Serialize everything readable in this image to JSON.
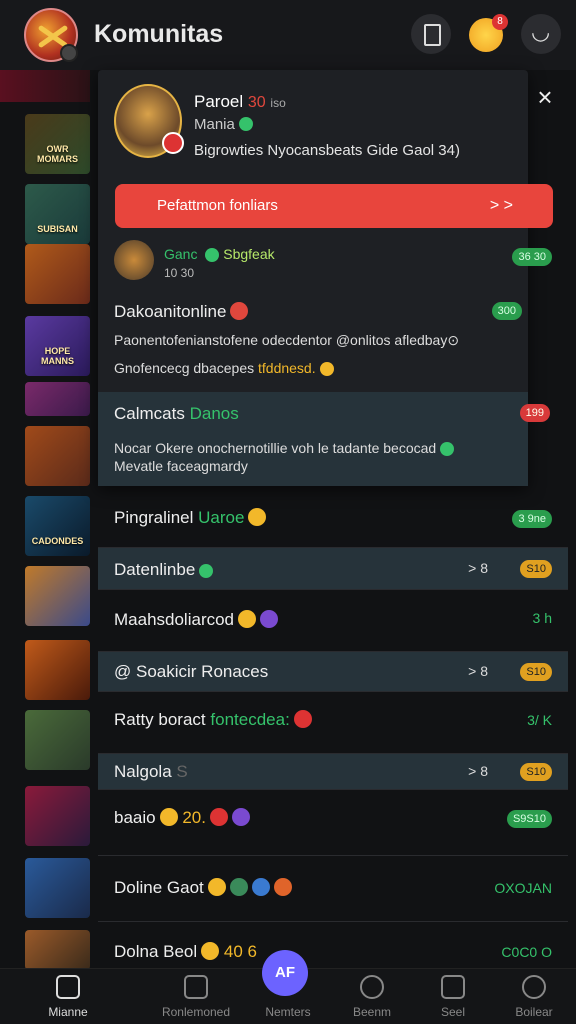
{
  "header": {
    "title": "Komunitas",
    "badge_count": "8"
  },
  "games": [
    {
      "label": "",
      "color": "#7a1e2a"
    },
    {
      "label": "OWR MOMARS",
      "color": "#2d4a2a"
    },
    {
      "label": "SUBISAN",
      "color": "#2d5a4a"
    },
    {
      "label": "",
      "color": "#8a3a1a"
    },
    {
      "label": "HOPE MANNS",
      "color": "#3a2a6a"
    },
    {
      "label": "",
      "color": "#5a2a4a"
    },
    {
      "label": "",
      "color": "#8a4a1a"
    },
    {
      "label": "CADONDES",
      "color": "#1a3a4a"
    },
    {
      "label": "",
      "color": "#6a4a2a"
    },
    {
      "label": "",
      "color": "#6a2a1a"
    },
    {
      "label": "",
      "color": "#3a5a3a"
    },
    {
      "label": "",
      "color": "#5a1a3a"
    },
    {
      "label": "",
      "color": "#2a3a5a"
    },
    {
      "label": "",
      "color": "#5a3a2a"
    }
  ],
  "overlay": {
    "name": "Paroel",
    "level": "30",
    "level_sub": "iso",
    "status": "Mania",
    "description": "Bigrowties Nyocansbeats Gide Gaol 34)",
    "cta": "Pefattmon fonliars",
    "cta_chevron": "> >",
    "sub_name": "Ganc",
    "sub_extra": "Sbgfeak",
    "sub_count": "10 30",
    "sub_pill": "36 30",
    "row1_title": "Dakoanitonline",
    "row1_pill": "300",
    "row1_l1": "Paonentofenianstofene odecdentor @onlitos afledbay⊙",
    "row1_l2a": "Gnofencecg dbacepes",
    "row1_l2b": "tfddnesd.",
    "row2_title": "Calmcats",
    "row2_title_b": "Danos",
    "row2_pill": "199",
    "row2_l1": "Nocar Okere onochernotillie voh le tadante becocad",
    "row2_l2": "Mevatle faceagmardy",
    "close": "×"
  },
  "rows": [
    {
      "title": "Pingralinel",
      "title_b": "Uaroe",
      "pill": "3 9ne",
      "pill_style": "green"
    },
    {
      "title": "Datenlinbe",
      "pill": "S10",
      "pill_style": "gold",
      "prefix": "> 8"
    },
    {
      "title": "Maahsdoliarcod",
      "meta": "3 h"
    },
    {
      "title": "@ Soakicir Ronaces",
      "pill": "S10",
      "pill_style": "gold",
      "prefix": "> 8"
    },
    {
      "title": "Ratty boract",
      "title_b": "fontecdea:",
      "meta": "3/ K"
    },
    {
      "title": "Nalgola",
      "title_c": "S",
      "pill": "S10",
      "pill_style": "gold",
      "prefix": "> 8"
    },
    {
      "title": "baaio",
      "title_d": "20.",
      "pill": "S9S10",
      "pill_style": "green"
    },
    {
      "title": "Doline Gaot",
      "meta": "OXOJAN"
    },
    {
      "title": "Dolna Beol",
      "title_d": "40 6",
      "meta": "C0C0 O"
    }
  ],
  "nav": [
    {
      "label": "Mianne"
    },
    {
      "label": "Ronlemoned"
    },
    {
      "label": "Nemters"
    },
    {
      "label": "Beenm"
    },
    {
      "label": "Seel"
    },
    {
      "label": "Boilear"
    }
  ],
  "fab": "AF"
}
